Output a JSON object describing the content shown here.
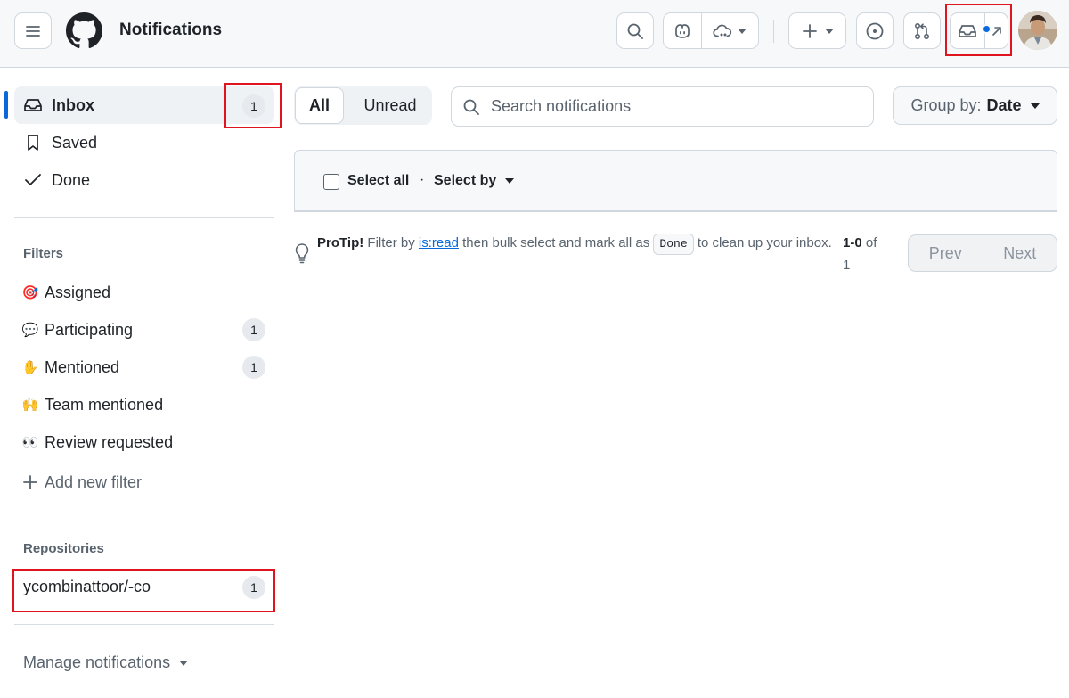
{
  "header": {
    "title": "Notifications",
    "menu_icon": "hamburger-icon",
    "logo_icon": "github-logo-icon",
    "search_icon": "search-icon",
    "copilot_icon": "copilot-icon",
    "copilot_dropdown_icon": "cloud-icon",
    "create_icon": "plus-icon",
    "issues_icon": "issue-circle-icon",
    "pulls_icon": "pull-request-icon",
    "inbox_icon": "inbox-icon",
    "open_icon": "arrow-up-right-icon"
  },
  "sidebar": {
    "inbox": {
      "label": "Inbox",
      "count": "1"
    },
    "saved": {
      "label": "Saved"
    },
    "done": {
      "label": "Done"
    },
    "filters_title": "Filters",
    "filters": [
      {
        "label": "Assigned",
        "emoji": "🎯",
        "count": ""
      },
      {
        "label": "Participating",
        "emoji": "💬",
        "count": "1"
      },
      {
        "label": "Mentioned",
        "emoji": "✋",
        "count": "1"
      },
      {
        "label": "Team mentioned",
        "emoji": "🙌",
        "count": ""
      },
      {
        "label": "Review requested",
        "emoji": "👀",
        "count": ""
      }
    ],
    "add_filter": "Add new filter",
    "repos_title": "Repositories",
    "repos": [
      {
        "name": "ycombinattoor/-co",
        "count": "1"
      }
    ],
    "manage": "Manage notifications"
  },
  "main": {
    "tabs": {
      "all": "All",
      "unread": "Unread"
    },
    "search_placeholder": "Search notifications",
    "group_by_label": "Group by:",
    "group_by_value": "Date",
    "select_all": "Select all",
    "separator": "·",
    "select_by": "Select by",
    "protip": {
      "title": "ProTip!",
      "pre": "Filter by",
      "link": "is:read",
      "mid": "then bulk select and mark all as",
      "kbd": "Done",
      "post": "to clean up your inbox."
    },
    "pagination": {
      "range": "1-0",
      "of": "of",
      "total": "1",
      "prev": "Prev",
      "next": "Next"
    }
  },
  "colors": {
    "accent": "#0969da",
    "highlight_box": "#e0141e",
    "muted": "#59636e"
  }
}
